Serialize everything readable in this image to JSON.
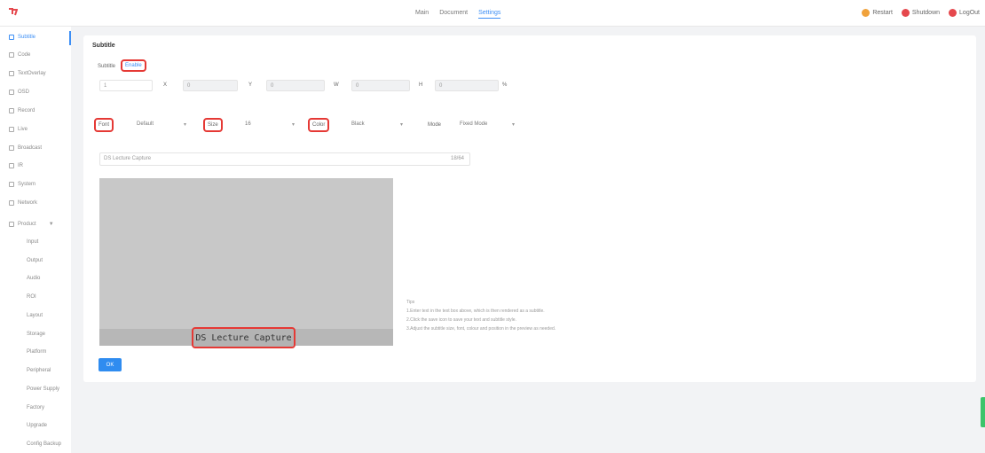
{
  "topbar": {
    "tabs": [
      {
        "label": "Main"
      },
      {
        "label": "Document"
      },
      {
        "label": "Settings"
      }
    ],
    "right_items": [
      {
        "label": "Restart",
        "color": "#f0a23c"
      },
      {
        "label": "Shutdown",
        "color": "#e5484d"
      },
      {
        "label": "LogOut",
        "color": "#e5484d"
      }
    ]
  },
  "sidebar": {
    "items": [
      {
        "label": "Subtitle"
      },
      {
        "label": "Code"
      },
      {
        "label": "TextOverlay"
      },
      {
        "label": "OSD"
      },
      {
        "label": "Record"
      },
      {
        "label": "Live"
      },
      {
        "label": "Broadcast"
      },
      {
        "label": "IR"
      },
      {
        "label": "System"
      },
      {
        "label": "Network"
      },
      {
        "label": "Product"
      }
    ],
    "sub_items": [
      {
        "label": "Input"
      },
      {
        "label": "Output"
      },
      {
        "label": "Audio"
      },
      {
        "label": "ROI"
      },
      {
        "label": "Layout"
      },
      {
        "label": "Storage"
      },
      {
        "label": "Platform"
      },
      {
        "label": "Peripheral"
      },
      {
        "label": "Power Supply"
      },
      {
        "label": "Factory"
      },
      {
        "label": "Upgrade"
      },
      {
        "label": "Config Backup"
      }
    ]
  },
  "card": {
    "title": "Subtitle",
    "subtitle_label": "Subtitle",
    "subtitle_value": "Enable",
    "coords": [
      {
        "value": "1",
        "unit": "X"
      },
      {
        "value": "0",
        "unit": "Y"
      },
      {
        "value": "0",
        "unit": "W"
      },
      {
        "value": "0",
        "unit": "H"
      },
      {
        "value": "0",
        "unit": "%"
      }
    ],
    "font_label": "Font",
    "font_value": "Default",
    "size_label": "Size",
    "size_value": "16",
    "color_label": "Color",
    "color_value": "Black",
    "mode_label": "Mode",
    "mode_value": "Fixed Mode",
    "text_placeholder": "DS Lecture Capture",
    "text_counter": "18/64",
    "caption": "DS Lecture Capture",
    "tips": [
      "Tips",
      "1.Enter text in the text box above, which is then rendered as a subtitle.",
      "2.Click the save icon to save your text and subtitle style.",
      "3.Adjust the subtitle size, font, colour and position in the preview as needed."
    ],
    "ok_label": "OK"
  }
}
